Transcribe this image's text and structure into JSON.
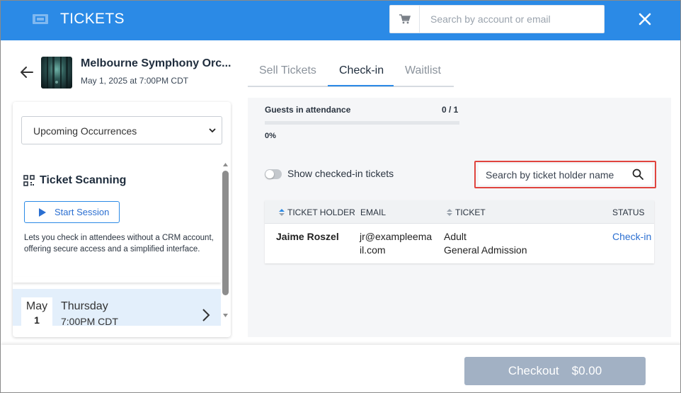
{
  "header": {
    "title": "TICKETS",
    "search_placeholder": "Search by account or email",
    "brand_color": "#2b8ae6"
  },
  "event": {
    "title": "Melbourne Symphony Orc...",
    "date": "May 1, 2025 at 7:00PM CDT"
  },
  "tabs": [
    {
      "label": "Sell Tickets",
      "active": false
    },
    {
      "label": "Check-in",
      "active": true
    },
    {
      "label": "Waitlist",
      "active": false
    }
  ],
  "left_panel": {
    "occurrence_select": "Upcoming Occurrences",
    "scanning_title": "Ticket Scanning",
    "start_button": "Start Session",
    "description": "Lets you check in attendees without a CRM account, offering secure access and a simplified interface.",
    "occurrence": {
      "month": "May",
      "day": "1",
      "weekday": "Thursday",
      "time": "7:00PM CDT"
    }
  },
  "attendance": {
    "label": "Guests in attendance",
    "count": "0 / 1",
    "percent_label": "0%",
    "percent_value": 0
  },
  "filters": {
    "toggle_label": "Show checked-in tickets",
    "toggle_on": false,
    "holder_search_placeholder": "Search by ticket holder name"
  },
  "table": {
    "columns": [
      "TICKET HOLDER",
      "EMAIL",
      "TICKET",
      "STATUS"
    ],
    "rows": [
      {
        "holder": "Jaime Roszel",
        "email_line1": "jr@exampleema",
        "email_line2": "il.com",
        "ticket_line1": "Adult",
        "ticket_line2": "General Admission",
        "status": "Check-in"
      }
    ]
  },
  "footer": {
    "checkout_label": "Checkout",
    "checkout_amount": "$0.00"
  },
  "icons": {
    "header": "ticket-icon",
    "cart": "cart-icon",
    "close": "close-icon",
    "back": "back-arrow-icon",
    "qr": "qr-code-icon",
    "play": "play-icon",
    "search": "search-icon"
  }
}
